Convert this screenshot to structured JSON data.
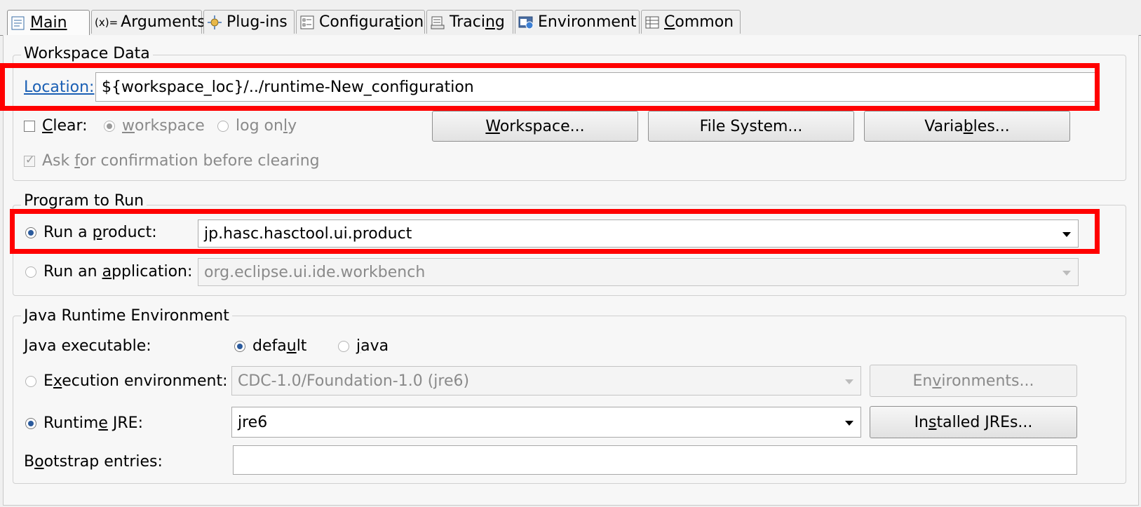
{
  "tabs": [
    {
      "label": "Main",
      "mnemonic_index": 0,
      "icon": "main-tab-icon",
      "active": true
    },
    {
      "label": "Arguments",
      "prefix": "(x)=",
      "mnemonic_index": -1,
      "icon": "arguments-icon"
    },
    {
      "label": "Plug-ins",
      "mnemonic_index": -1,
      "icon": "plugins-icon"
    },
    {
      "label": "Configuration",
      "mnemonic_index": 10,
      "icon": "configuration-icon"
    },
    {
      "label": "Tracing",
      "mnemonic_index": 4,
      "icon": "tracing-icon"
    },
    {
      "label": "Environment",
      "mnemonic_index": -1,
      "icon": "environment-icon"
    },
    {
      "label": "Common",
      "mnemonic_index": 0,
      "icon": "common-icon"
    }
  ],
  "workspace": {
    "legend": "Workspace Data",
    "location_label": "Location:",
    "location_value": "${workspace_loc}/../runtime-New_configuration",
    "clear_label": "Clear:",
    "radio_workspace": "workspace",
    "radio_log_only": "log only",
    "btn_workspace": "Workspace...",
    "btn_file_system": "File System...",
    "btn_variables": "Variables...",
    "ask_confirm": "Ask for confirmation before clearing"
  },
  "program": {
    "legend": "Program to Run",
    "run_product_label": "Run a product:",
    "run_product_value": "jp.hasc.hasctool.ui.product",
    "run_app_label": "Run an application:",
    "run_app_value": "org.eclipse.ui.ide.workbench"
  },
  "jre": {
    "legend": "Java Runtime Environment",
    "java_exec_label": "Java executable:",
    "opt_default": "default",
    "opt_java": "java",
    "exec_env_label": "Execution environment:",
    "exec_env_value": "CDC-1.0/Foundation-1.0 (jre6)",
    "btn_environments": "Environments...",
    "runtime_jre_label": "Runtime JRE:",
    "runtime_jre_value": "jre6",
    "btn_installed_jres": "Installed JREs...",
    "bootstrap_label": "Bootstrap entries:",
    "bootstrap_value": ""
  },
  "colors": {
    "highlight": "#ff0000",
    "link": "#1a5fb4",
    "radio_selected": "#2a5a9c"
  }
}
